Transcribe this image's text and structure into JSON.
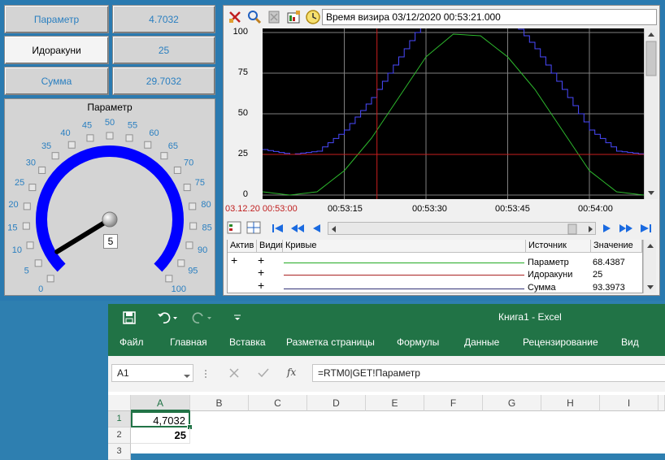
{
  "scada": {
    "cells": {
      "param_label": "Параметр",
      "param_value": "4.7032",
      "idora_label": "Идоракуни",
      "idora_value": "25",
      "sum_label": "Сумма",
      "sum_value": "29.7032"
    },
    "gauge": {
      "title": "Параметр",
      "value_display": "5",
      "scale": [
        "0",
        "5",
        "10",
        "15",
        "20",
        "25",
        "30",
        "35",
        "40",
        "45",
        "50",
        "55",
        "60",
        "65",
        "70",
        "75",
        "80",
        "85",
        "90",
        "95",
        "100"
      ],
      "value": 5,
      "min": 0,
      "max": 100,
      "arc_color": "#0000ff",
      "label_color": "#2a7fc0"
    }
  },
  "trend": {
    "toolbar_icons": [
      "pan-icon",
      "zoom-icon",
      "print-icon",
      "properties-icon",
      "clock-icon"
    ],
    "time_label": "Время визира 03/12/2020 00:53:21.000",
    "yticks": [
      "100",
      "75",
      "50",
      "25",
      "0"
    ],
    "xstart": "03.12.20 00:53:00",
    "xticks": [
      "00:53:15",
      "00:53:30",
      "00:53:45",
      "00:54:00"
    ],
    "nav_icons": [
      "first-icon",
      "rewind-icon",
      "back-icon",
      "forward-icon",
      "fast-forward-icon",
      "last-icon"
    ],
    "grid": {
      "headers": [
        "Актив",
        "Видим",
        "Кривые",
        "Источник",
        "Значение"
      ],
      "rows": [
        {
          "active": "+",
          "visible": "+",
          "color": "#22aa22",
          "source": "Параметр",
          "value": "68.4387"
        },
        {
          "active": "",
          "visible": "+",
          "color": "#aa2222",
          "source": "Идоракуни",
          "value": "25"
        },
        {
          "active": "",
          "visible": "+",
          "color": "#333377",
          "source": "Сумма",
          "value": "93.3973"
        }
      ]
    },
    "colors": {
      "bg": "#000000",
      "param": "#2db82d",
      "idora": "#c81e1e",
      "sum": "#4a4aff",
      "cursor": "#c81e1e"
    }
  },
  "chart_data": {
    "type": "line",
    "ylim": [
      0,
      100
    ],
    "xticks": [
      "00:53:15",
      "00:53:30",
      "00:53:45",
      "00:54:00"
    ],
    "cursor_time": "00:53:21",
    "series": [
      {
        "name": "Параметр",
        "t": [
          0,
          5,
          10,
          15,
          20,
          25,
          30,
          35,
          40,
          45,
          50,
          55,
          60,
          65,
          70
        ],
        "values": [
          2,
          0,
          2,
          15,
          35,
          60,
          85,
          99,
          98,
          85,
          65,
          40,
          15,
          2,
          0,
          25
        ]
      },
      {
        "name": "Идоракуни",
        "constant": 25
      },
      {
        "name": "Сумма",
        "t": [
          0,
          5,
          10,
          15,
          20,
          25,
          30,
          35,
          40,
          45,
          50,
          55,
          60,
          65,
          70
        ],
        "values": [
          28,
          25,
          27,
          40,
          60,
          85,
          110,
          124,
          123,
          110,
          90,
          65,
          40,
          27,
          25,
          50
        ]
      }
    ]
  },
  "excel": {
    "title": "Книга1 - Excel",
    "menu": [
      "Файл",
      "Главная",
      "Вставка",
      "Разметка страницы",
      "Формулы",
      "Данные",
      "Рецензирование",
      "Вид"
    ],
    "namebox": "A1",
    "formula": "=RTM0|GET!Параметр",
    "fx": "fx",
    "columns": [
      "A",
      "B",
      "C",
      "D",
      "E",
      "F",
      "G",
      "H",
      "I"
    ],
    "rows": [
      "1",
      "2",
      "3"
    ],
    "a1": "4,7032",
    "a2": "25"
  }
}
